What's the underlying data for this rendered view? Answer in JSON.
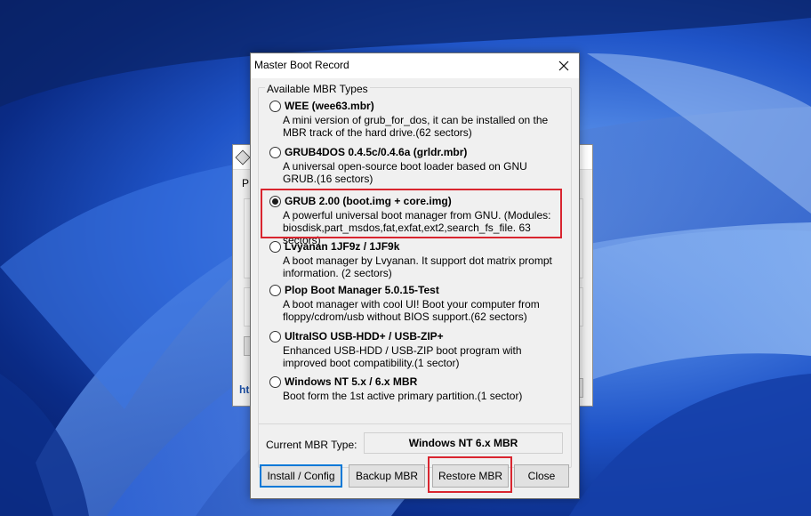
{
  "background_window": {
    "tab_fragment": "P",
    "link_fragment": "ht"
  },
  "dialog": {
    "title": "Master Boot Record",
    "group_title": "Available MBR Types",
    "options": [
      {
        "title": "WEE (wee63.mbr)",
        "desc": "A mini version of grub_for_dos, it can be installed on the MBR track of the hard drive.(62 sectors)",
        "checked": false
      },
      {
        "title": "GRUB4DOS 0.4.5c/0.4.6a (grldr.mbr)",
        "desc": "A universal open-source boot loader based on GNU GRUB.(16 sectors)",
        "checked": false
      },
      {
        "title": "GRUB 2.00 (boot.img + core.img)",
        "desc": "A powerful universal boot manager from GNU. (Modules: biosdisk,part_msdos,fat,exfat,ext2,search_fs_file. 63 sectors)",
        "checked": true
      },
      {
        "title": "Lvyanan 1JF9z / 1JF9k",
        "desc": "A boot manager by Lvyanan. It support dot matrix prompt information. (2 sectors)",
        "checked": false
      },
      {
        "title": "Plop Boot Manager 5.0.15-Test",
        "desc": "A boot manager with cool UI! Boot your computer from floppy/cdrom/usb without BIOS support.(62 sectors)",
        "checked": false
      },
      {
        "title": "UltraISO USB-HDD+ / USB-ZIP+",
        "desc": "Enhanced USB-HDD / USB-ZIP boot program with improved boot compatibility.(1 sector)",
        "checked": false
      },
      {
        "title": "Windows NT 5.x / 6.x MBR",
        "desc": "Boot form the 1st active primary partition.(1 sector)",
        "checked": false
      }
    ],
    "current_label": "Current MBR Type:",
    "current_value": "Windows NT 6.x MBR",
    "buttons": {
      "install": "Install / Config",
      "backup": "Backup MBR",
      "restore": "Restore MBR",
      "close": "Close"
    }
  },
  "colors": {
    "highlight_red": "#d9252f",
    "focus_blue": "#0078d7",
    "dialog_bg": "#f0f0f0"
  },
  "icons": [
    "close-icon",
    "radio-icon",
    "app-icon"
  ]
}
